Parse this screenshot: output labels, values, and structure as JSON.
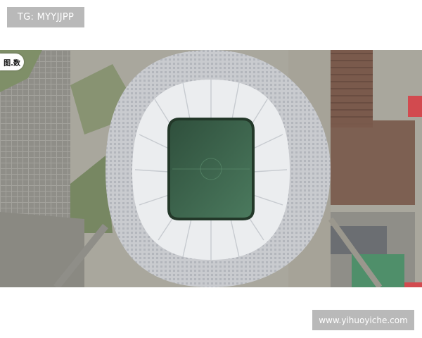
{
  "top_tag": {
    "text": "TG: MYYJJPP"
  },
  "photo": {
    "subject": "aerial-satellite-view",
    "colors": {
      "asphalt": "#a9a79d",
      "pitch": "#3a5f48",
      "roof": "#ebedef",
      "concourse": "#cfd1d4",
      "parking_lot": "#8f8e88",
      "grass": "#7f8f68",
      "rust_roof": "#7a5a4c",
      "green_roof": "#4f8f6a",
      "red_roof": "#d24a4f"
    }
  },
  "corner_badge": {
    "text": "图.数"
  },
  "bottom_watermark": {
    "text": "www.yihuoyiche.com"
  }
}
